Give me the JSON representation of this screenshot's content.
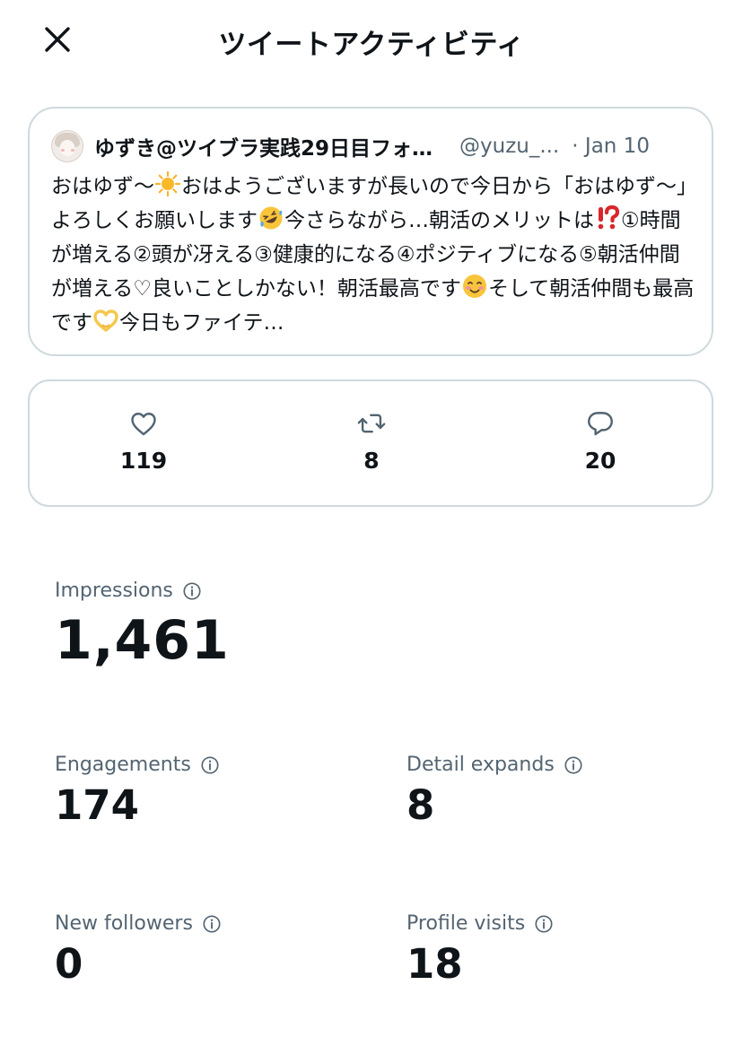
{
  "header": {
    "title": "ツイートアクティビティ",
    "close_icon": "close-icon"
  },
  "tweet": {
    "author": "ゆずき@ツイブラ実践29日目フォ…",
    "handle": "@yuzu_...",
    "date": "· Jan 10",
    "text": [
      {
        "t": "おはゆず〜"
      },
      {
        "emoji": "sun-emoji"
      },
      {
        "t": "おはようございますが長いので今日から「おはゆず〜」よろしくお願いします"
      },
      {
        "emoji": "rofl-emoji"
      },
      {
        "t": "今さらながら…朝活のメリットは"
      },
      {
        "emoji": "exclamation-question-emoji"
      },
      {
        "t": "①時間が増える②頭が冴える③健康的になる④ポジティブになる⑤朝活仲間が増える♡良いことしかない！朝活最高です"
      },
      {
        "emoji": "smiling-blush-emoji"
      },
      {
        "t": "そして朝活仲間も最高です"
      },
      {
        "emoji": "heart-hands-emoji"
      },
      {
        "t": "今日もファイテ…"
      }
    ]
  },
  "stats": {
    "likes": "119",
    "retweets": "8",
    "replies": "20"
  },
  "metrics": {
    "impressions": {
      "label": "Impressions",
      "value": "1,461"
    },
    "engagements": {
      "label": "Engagements",
      "value": "174"
    },
    "detail_expands": {
      "label": "Detail expands",
      "value": "8"
    },
    "new_followers": {
      "label": "New followers",
      "value": "0"
    },
    "profile_visits": {
      "label": "Profile visits",
      "value": "18"
    }
  },
  "colors": {
    "text": "#0f1419",
    "secondary": "#536471",
    "border": "#cfd9de"
  }
}
